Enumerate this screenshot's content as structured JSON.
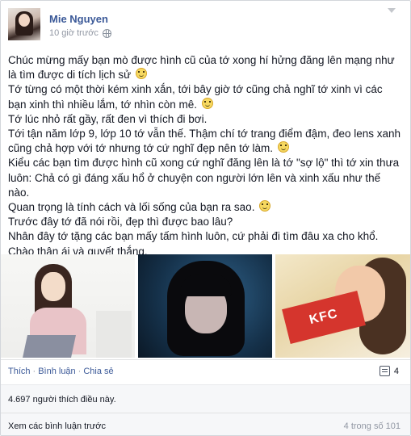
{
  "post": {
    "author": "Mie Nguyen",
    "timestamp": "10 giờ trước",
    "privacy_icon": "globe-icon",
    "paragraph_lines": [
      "Chúc mừng mấy bạn mò được hình cũ của tớ xong hí hửng đăng lên mạng như là tìm được di tích lịch sử",
      "Tớ từng có một thời kém xinh xắn, tới bây giờ tớ cũng chả nghĩ tớ xinh vì các bạn xinh thì nhiều lắm, tớ nhìn còn mê.",
      "Tớ lúc nhỏ rất gầy, rất đen vì thích đi bơi.",
      "Tới tận năm lớp 9, lớp 10 tớ vẫn thế. Thậm chí tớ trang điểm đậm, đeo lens xanh cũng chả hợp với tớ nhưng tớ cứ nghĩ đẹp nên tớ làm.",
      "Kiểu các bạn tìm được hình cũ xong cứ nghĩ đăng lên là tớ \"sợ lộ\" thì tớ xin thưa luôn: Chả có gì đáng xấu hổ ở chuyện con người lớn lên và xinh xấu như thế nào.",
      "Quan trọng là tính cách và lối sống của bạn ra sao.",
      "Trước đây tớ đã nói rồi, đẹp thì được bao lâu?",
      "Nhân đây tớ tặng các bạn mấy tấm hình luôn, cứ phải đi tìm đâu xa cho khổ.",
      "Chào thân ái và quyết thắng."
    ],
    "photos": [
      "photo-1",
      "photo-2",
      "photo-3"
    ],
    "photo3_sign": "KFC"
  },
  "actions": {
    "like": "Thích",
    "comment": "Bình luận",
    "share": "Chia sẻ",
    "comment_count": "4"
  },
  "likes": {
    "text": "4.697 người thích điều này."
  },
  "comments": {
    "view_previous": "Xem các bình luận trước",
    "count": "4 trong số 101"
  }
}
